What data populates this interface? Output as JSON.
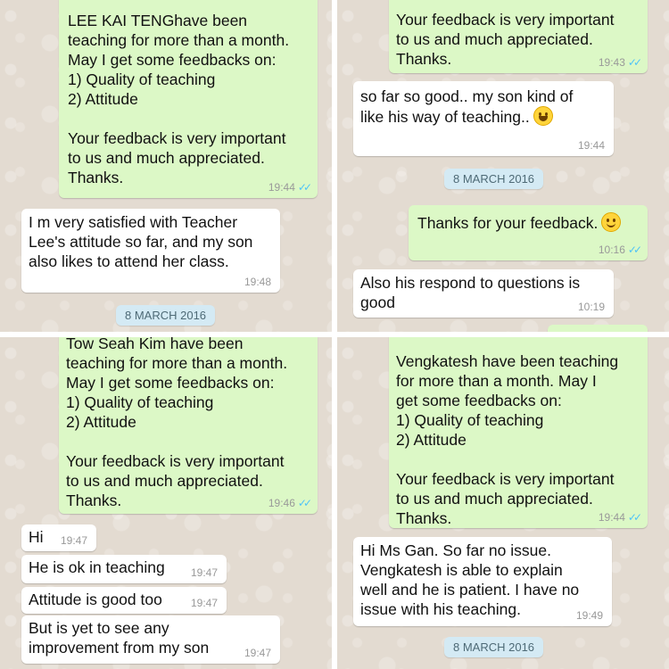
{
  "panels": {
    "tl": {
      "out_msg": {
        "text": "LEE KAI TENGhave been\nteaching for more than a month.\nMay I get some feedbacks on:\n1) Quality of teaching\n2) Attitude\n\nYour feedback is very important\nto us and much appreciated.\nThanks.",
        "time": "19:44"
      },
      "in_msg": {
        "text": "I m very satisfied with Teacher\nLee's attitude so far, and my son\nalso likes to attend her class.",
        "time": "19:48"
      },
      "date": "8 MARCH 2016"
    },
    "tr": {
      "out_msg_top": {
        "text": "Your feedback is very important\nto us and much appreciated.\nThanks.",
        "time": "19:43"
      },
      "in_msg": {
        "text": "so far so good.. my son kind of\nlike his way of teaching..",
        "time": "19:44",
        "emoji": "grinning-face"
      },
      "date": "8 MARCH 2016",
      "out_msg": {
        "text": "Thanks for your feedback.",
        "time": "10:16",
        "emoji": "smiling-face"
      },
      "in_msg2": {
        "text": "Also his respond to questions is\ngood",
        "time": "10:19"
      }
    },
    "bl": {
      "out_msg": {
        "text": "Tow Seah Kim have been\nteaching for more than a month.\nMay I get some feedbacks on:\n1) Quality of teaching\n2) Attitude\n\nYour feedback is very important\nto us and much appreciated.\nThanks.",
        "time": "19:46"
      },
      "replies": [
        {
          "text": "Hi",
          "time": "19:47"
        },
        {
          "text": "He is ok in teaching",
          "time": "19:47"
        },
        {
          "text": "Attitude is good too",
          "time": "19:47"
        },
        {
          "text": "But is yet to see any\nimprovement from my son",
          "time": "19:47"
        }
      ]
    },
    "br": {
      "out_msg": {
        "text": "Vengkatesh have been teaching\nfor more than a month. May I\nget some feedbacks on:\n1) Quality of teaching\n2) Attitude\n\nYour feedback is very important\nto us and much appreciated.\nThanks.",
        "time": "19:44"
      },
      "in_msg": {
        "text": "Hi Ms Gan. So far no issue.\nVengkatesh is able to explain\nwell and he is patient. I have no\nissue with his teaching.",
        "time": "19:49"
      },
      "date": "8 MARCH 2016"
    }
  },
  "colors": {
    "outgoing_bubble": "#dcf8c6",
    "incoming_bubble": "#ffffff",
    "chat_background": "#e3dbd1",
    "date_chip": "#d4eaf4",
    "read_ticks": "#4fc3f7"
  }
}
